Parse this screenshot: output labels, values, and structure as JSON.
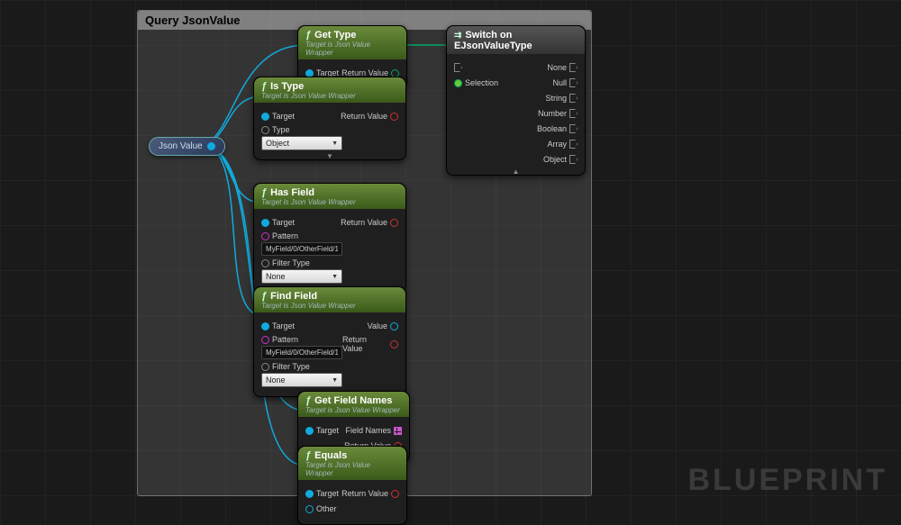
{
  "comment_title": "Query JsonValue",
  "watermark": "BLUEPRINT",
  "var_node": {
    "label": "Json Value"
  },
  "wrapper_sub": "Target is Json Value Wrapper",
  "nodes": {
    "getType": {
      "title": "Get Type",
      "pins": {
        "target": "Target",
        "return": "Return Value"
      }
    },
    "isType": {
      "title": "Is Type",
      "pins": {
        "target": "Target",
        "type": "Type",
        "return": "Return Value"
      },
      "dropdown_value": "Object"
    },
    "hasField": {
      "title": "Has Field",
      "pins": {
        "target": "Target",
        "pattern": "Pattern",
        "filter": "Filter Type",
        "return": "Return Value"
      },
      "pattern_value": "MyField/0/OtherField/1",
      "filter_value": "None"
    },
    "findField": {
      "title": "Find Field",
      "pins": {
        "target": "Target",
        "pattern": "Pattern",
        "filter": "Filter Type",
        "value": "Value",
        "return": "Return Value"
      },
      "pattern_value": "MyField/0/OtherField/1",
      "filter_value": "None"
    },
    "getFieldNames": {
      "title": "Get Field Names",
      "pins": {
        "target": "Target",
        "fieldnames": "Field Names",
        "return": "Return Value"
      }
    },
    "equals": {
      "title": "Equals",
      "pins": {
        "target": "Target",
        "other": "Other",
        "return": "Return Value"
      }
    },
    "switch": {
      "title": "Switch on EJsonValueType",
      "pins": {
        "selection": "Selection",
        "outs": [
          "None",
          "Null",
          "String",
          "Number",
          "Boolean",
          "Array",
          "Object"
        ]
      }
    }
  }
}
